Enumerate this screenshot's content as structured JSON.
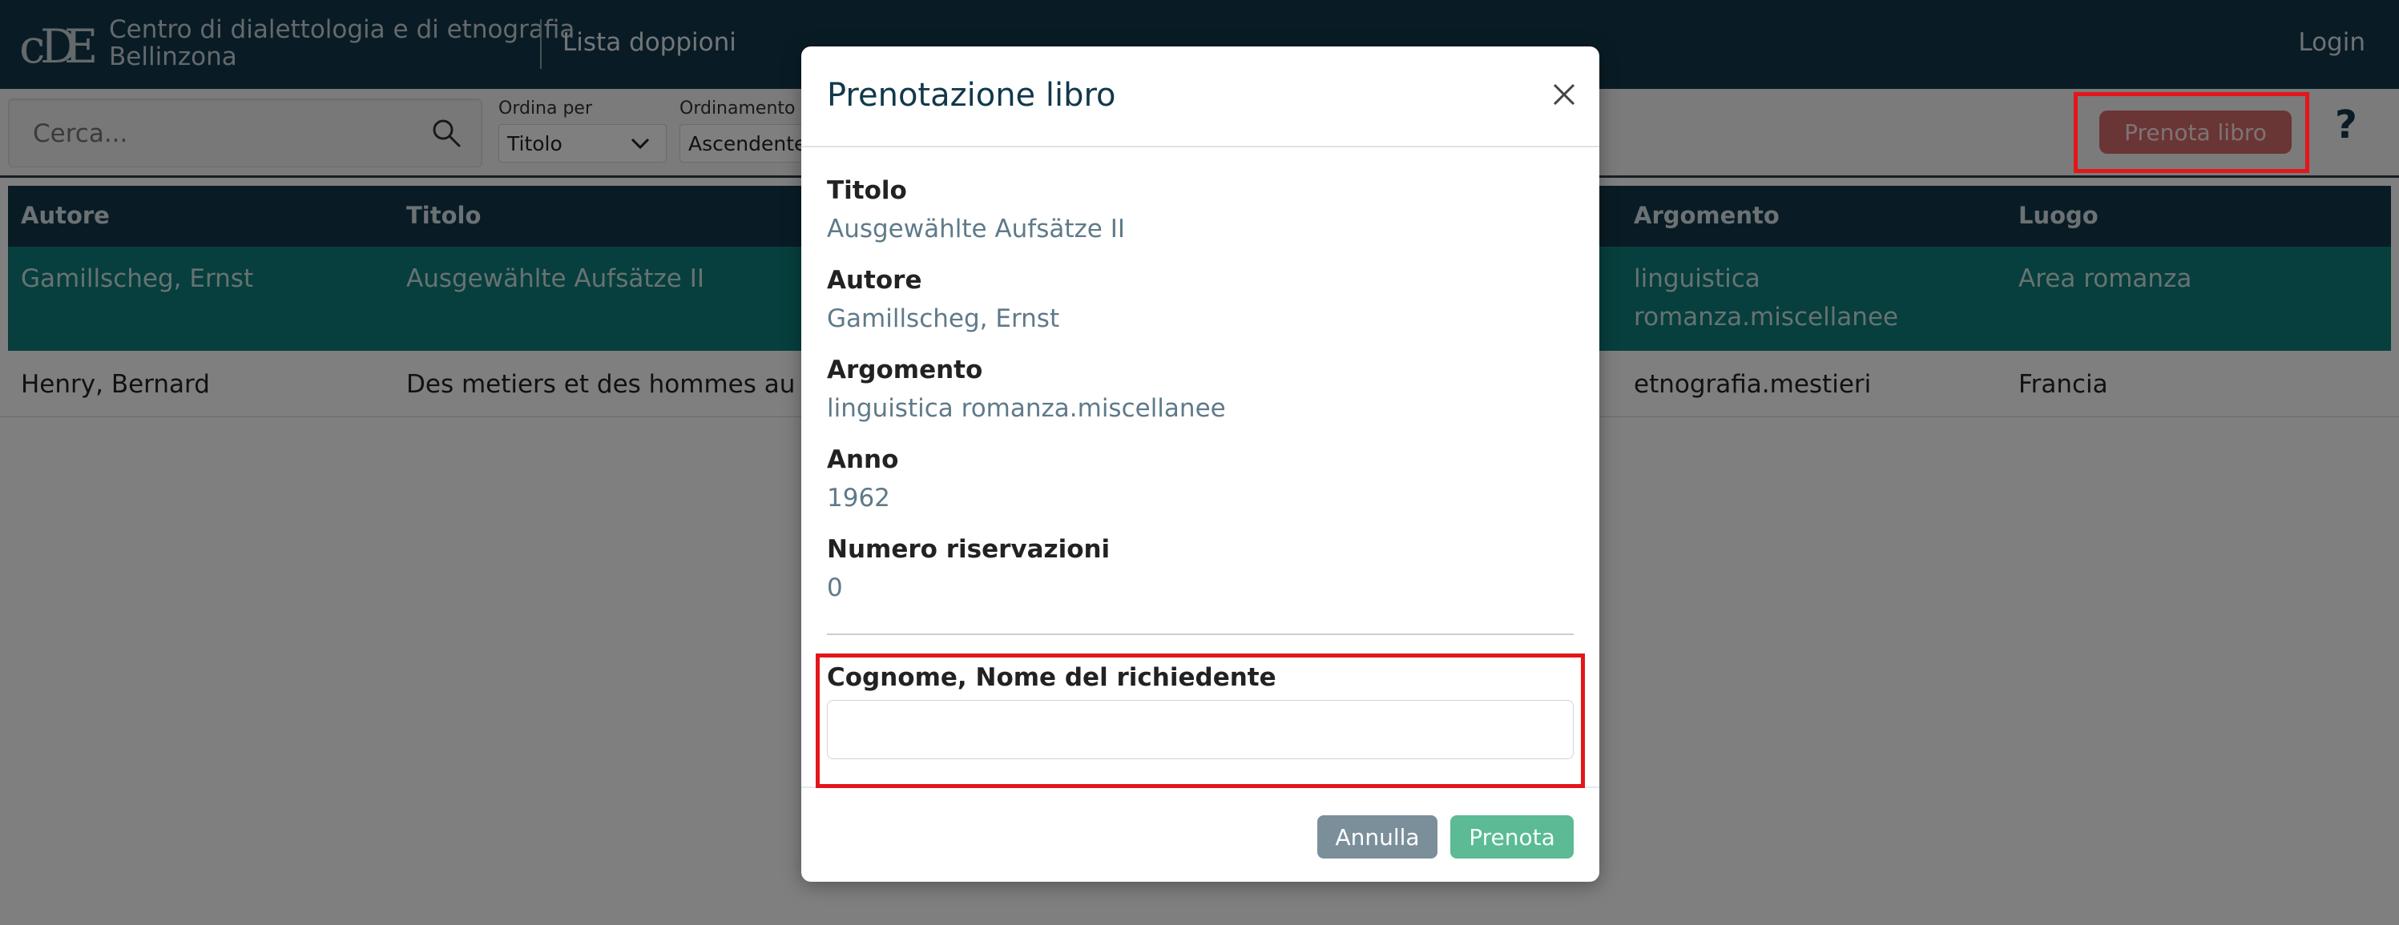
{
  "header": {
    "logo_icon": "cde-monogram-logo",
    "logo_line1": "Centro di dialettologia e di etnografia",
    "logo_line2": "Bellinzona",
    "app_title": "Lista doppioni",
    "login_label": "Login"
  },
  "toolbar": {
    "search_placeholder": "Cerca...",
    "search_icon": "search-icon",
    "sort_by_label": "Ordina per",
    "sort_by_value": "Titolo",
    "order_label": "Ordinamento",
    "order_value": "Ascendente",
    "reserve_button": "Prenota libro",
    "help_label": "?"
  },
  "table": {
    "columns": [
      "Autore",
      "Titolo",
      "Argomento",
      "Luogo"
    ],
    "rows": [
      {
        "autore": "Gamillscheg, Ernst",
        "titolo": "Ausgewählte Aufsätze II",
        "argomento_line1": "linguistica",
        "argomento_line2": "romanza.miscellanee",
        "luogo": "Area romanza",
        "selected": true
      },
      {
        "autore": "Henry, Bernard",
        "titolo": "Des metiers et des hommes au vill",
        "argomento_line1": "etnografia.mestieri",
        "argomento_line2": "",
        "luogo": "Francia",
        "selected": false
      }
    ]
  },
  "modal": {
    "title": "Prenotazione libro",
    "close_icon": "close-icon",
    "fields": [
      {
        "label": "Titolo",
        "value": "Ausgewählte Aufsätze II"
      },
      {
        "label": "Autore",
        "value": "Gamillscheg, Ernst"
      },
      {
        "label": "Argomento",
        "value": "linguistica romanza.miscellanee"
      },
      {
        "label": "Anno",
        "value": "1962"
      },
      {
        "label": "Numero riservazioni",
        "value": "0"
      }
    ],
    "requester_label": "Cognome, Nome del richiedente",
    "requester_value": "",
    "cancel_button": "Annulla",
    "submit_button": "Prenota"
  },
  "colors": {
    "header_bg": "#12384b",
    "selected_row_bg": "#0d7e7a",
    "reserve_button_bg": "#d46a6a",
    "submit_button_bg": "#5cba95",
    "cancel_button_bg": "#7b8f9b",
    "highlight_border": "#e3161a"
  }
}
